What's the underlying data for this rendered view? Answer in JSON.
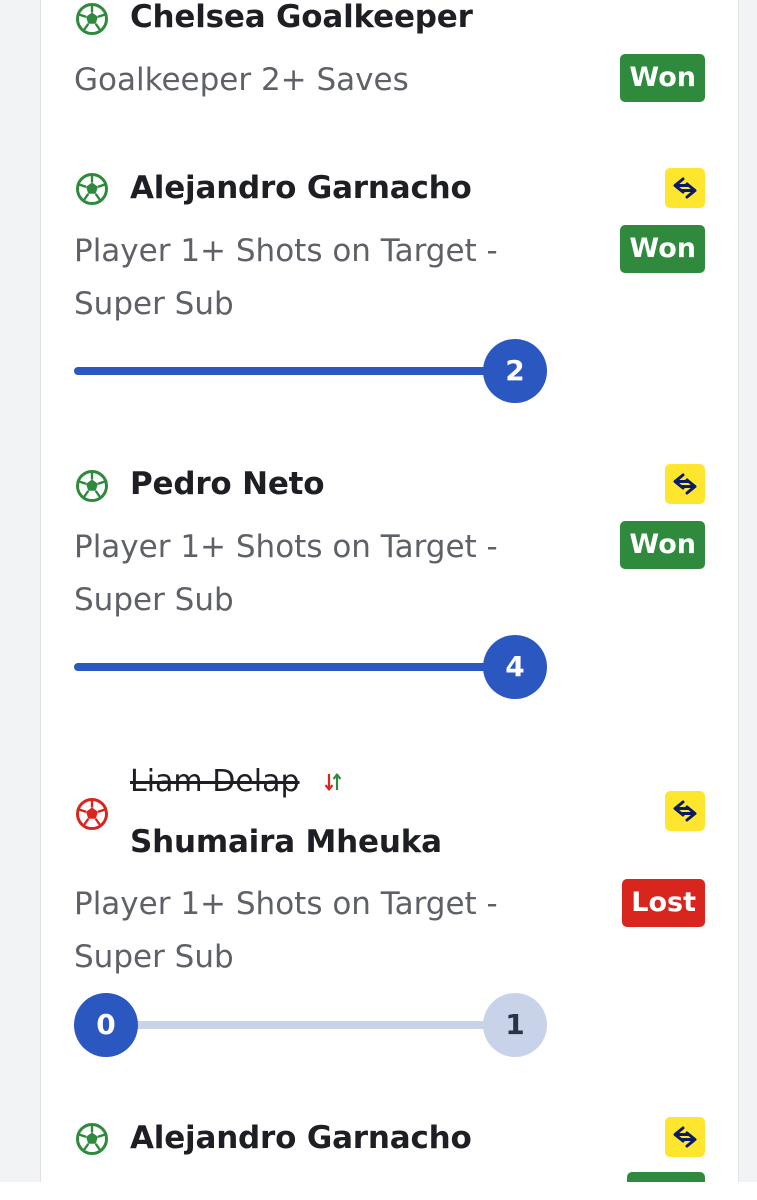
{
  "legs": [
    {
      "player": "Chelsea Goalkeeper",
      "market": "Goalkeeper 2+ Saves",
      "status": "Won",
      "status_color": "#2f8a3e",
      "icon": "football-icon-green"
    },
    {
      "player": "Alejandro Garnacho",
      "market": "Player 1+ Shots on Target - Super Sub",
      "status": "Won",
      "status_color": "#2f8a3e",
      "icon": "football-icon-green",
      "super_sub_icon": "swap-arrows-icon",
      "progress": {
        "current": "2",
        "target": "2",
        "fraction": 1.0
      }
    },
    {
      "player": "Pedro Neto",
      "market": "Player 1+ Shots on Target - Super Sub",
      "status": "Won",
      "status_color": "#2f8a3e",
      "icon": "football-icon-green",
      "super_sub_icon": "swap-arrows-icon",
      "progress": {
        "current": "4",
        "target": "4",
        "fraction": 1.0
      }
    },
    {
      "original_player": "Liam Delap",
      "player": "Shumaira Mheuka",
      "market": "Player 1+ Shots on Target - Super Sub",
      "status": "Lost",
      "status_color": "#d8261f",
      "icon": "football-icon-red",
      "substitution_icon": "substitution-arrows-icon",
      "super_sub_icon": "swap-arrows-icon",
      "progress": {
        "current": "0",
        "target": "1",
        "fraction": 0.0
      }
    },
    {
      "player": "Alejandro Garnacho",
      "icon": "football-icon-green",
      "super_sub_icon": "swap-arrows-icon",
      "status_color": "#2f8a3e"
    }
  ],
  "colors": {
    "won": "#2f8a3e",
    "lost": "#d8261f",
    "progress_filled": "#2b57c0",
    "progress_empty": "#c8d3ea",
    "super_sub_badge": "#ffe62e"
  }
}
